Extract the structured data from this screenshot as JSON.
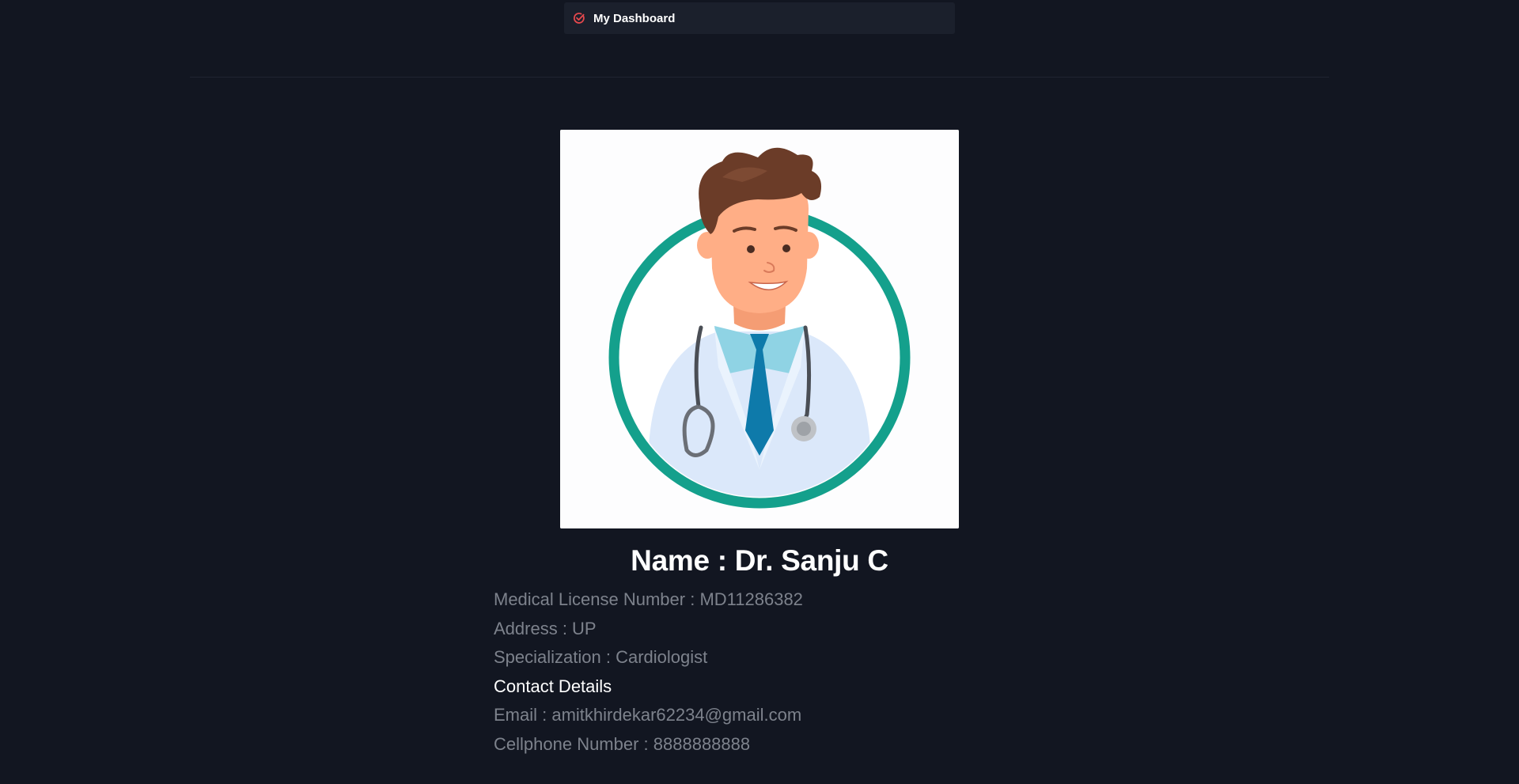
{
  "nav": {
    "title": "My Dashboard",
    "icon": "check-circle-icon",
    "icon_color": "#e5484d"
  },
  "profile": {
    "image_alt": "doctor-avatar",
    "name": "Name : Dr. Sanju C",
    "license": "Medical License Number : MD11286382",
    "address": "Address : UP",
    "specialization": "Specialization : Cardiologist",
    "contact_heading": "Contact Details",
    "email": "Email : amitkhirdekar62234@gmail.com",
    "phone": "Cellphone Number : 8888888888"
  },
  "colors": {
    "background": "#121621",
    "nav_background": "#1b202c",
    "ring": "#14a08c",
    "muted_text": "#7d828c"
  }
}
